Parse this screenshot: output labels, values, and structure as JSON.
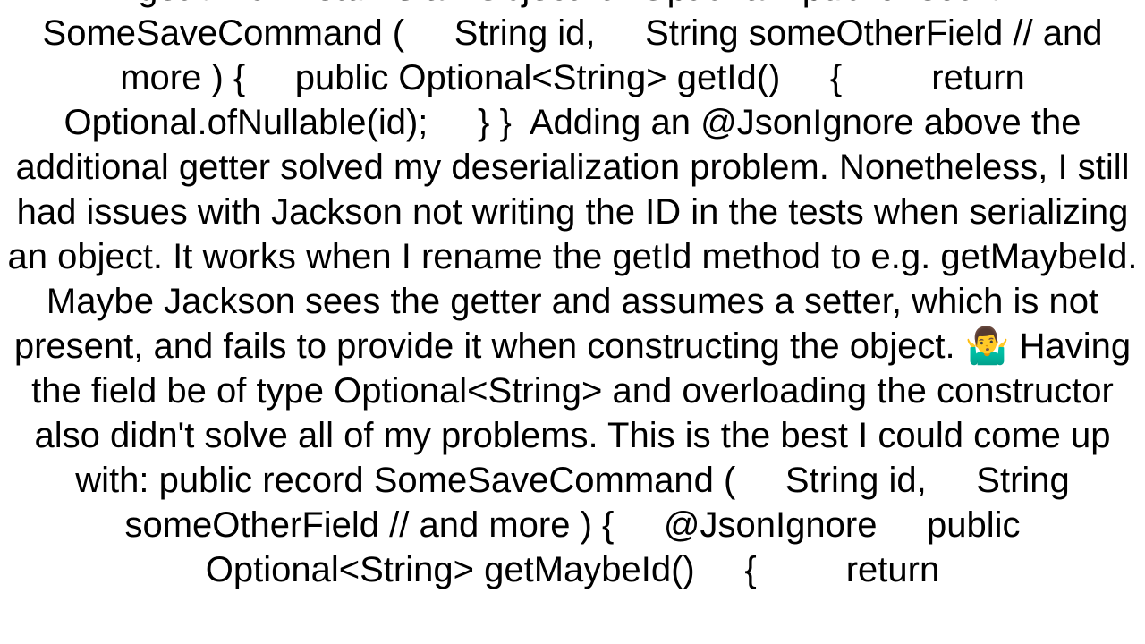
{
  "document": {
    "body": "getId now returns an Object for Optional:  public record SomeSaveCommand (     String id,     String someOtherField // and more ) {     public Optional<String> getId()     {         return Optional.ofNullable(id);     } }  Adding an @JsonIgnore above the additional getter solved my deserialization problem. Nonetheless, I still had issues with Jackson not writing the ID in the tests when serializing an object. It works when I rename the getId method to e.g. getMaybeId. Maybe Jackson sees the getter and assumes a setter, which is not present, and fails to provide it when constructing the object. 🤷‍♂️ Having the field be of type Optional<String> and overloading the constructor also didn't solve all of my problems. This is the best I could come up with: public record SomeSaveCommand (     String id,     String someOtherField // and more ) {     @JsonIgnore     public Optional<String> getMaybeId()     {         return"
  }
}
